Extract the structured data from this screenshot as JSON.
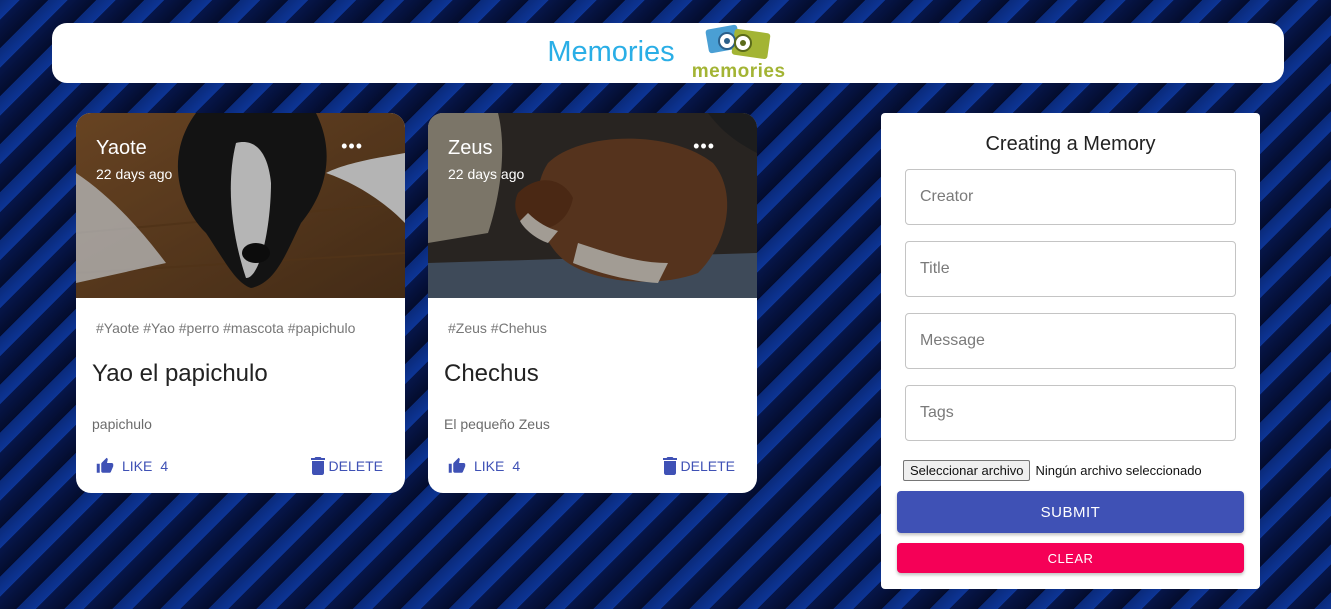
{
  "header": {
    "title": "Memories",
    "logo_text": "memories",
    "title_color": "#2aaee6",
    "logo_color": "#a3b434"
  },
  "posts": [
    {
      "creator": "Yaote",
      "time": "22 days ago",
      "tags": "#Yaote #Yao #perro #mascota #papichulo",
      "title": "Yao el papichulo",
      "message": "papichulo",
      "like_label": "LIKE",
      "like_count": "4",
      "delete_label": "DELETE",
      "more_icon": "more-horiz-icon"
    },
    {
      "creator": "Zeus",
      "time": "22 days ago",
      "tags": "#Zeus #Chehus",
      "title": "Chechus",
      "message": "El pequeño Zeus",
      "like_label": "LIKE",
      "like_count": "4",
      "delete_label": "DELETE",
      "more_icon": "more-horiz-icon"
    }
  ],
  "form": {
    "title": "Creating a Memory",
    "creator_placeholder": "Creator",
    "title_placeholder": "Title",
    "message_placeholder": "Message",
    "tags_placeholder": "Tags",
    "file_button_label": "Seleccionar archivo",
    "file_status": "Ningún archivo seleccionado",
    "submit_label": "SUBMIT",
    "clear_label": "CLEAR"
  },
  "colors": {
    "primary": "#3f51b5",
    "secondary": "#f50057"
  }
}
